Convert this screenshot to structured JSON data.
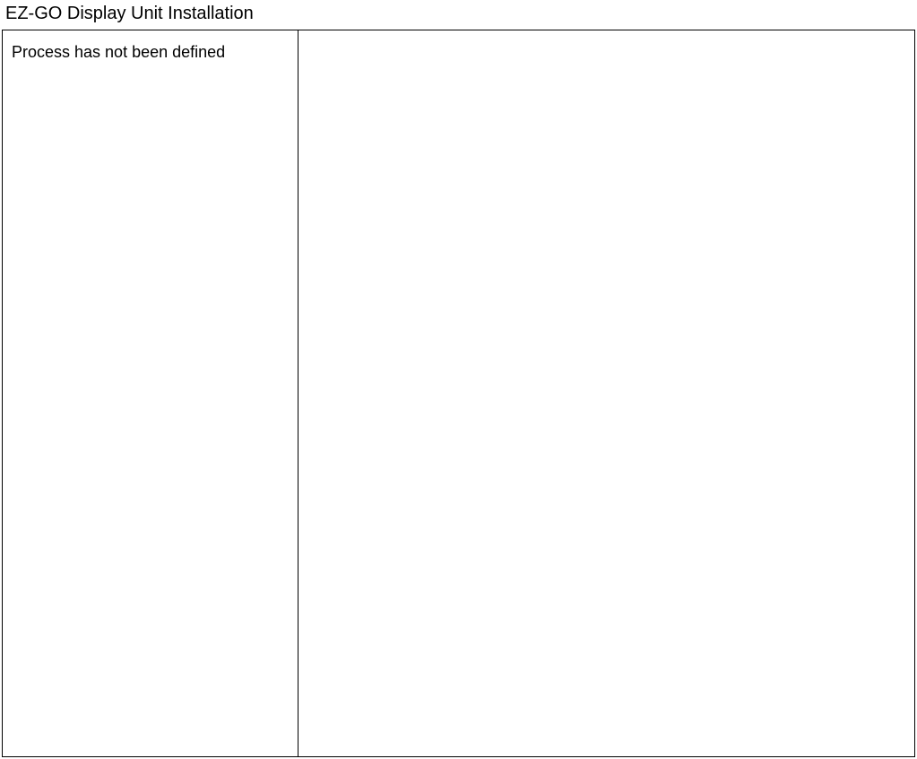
{
  "header": {
    "title": "EZ-GO Display Unit Installation"
  },
  "leftPanel": {
    "message": "Process has not been defined"
  }
}
